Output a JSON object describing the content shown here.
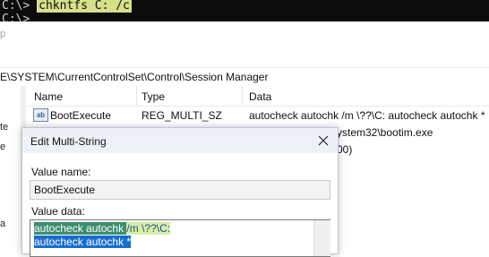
{
  "console": {
    "prompt1": "C:\\> ",
    "command": "chkntfs C: /c",
    "prompt2": "C:\\>"
  },
  "regedit": {
    "menu_fragment": "p",
    "address": "E\\SYSTEM\\CurrentControlSet\\Control\\Session Manager",
    "tree_fragments": [
      "te",
      "e",
      "a"
    ],
    "columns": {
      "name": "Name",
      "type": "Type",
      "data": "Data"
    },
    "rows": [
      {
        "icon": "ab",
        "name": "BootExecute",
        "type": "REG_MULTI_SZ",
        "data": "autocheck autochk /m \\??\\C: autocheck autochk *"
      },
      {
        "name": "",
        "type": "",
        "data": "ystem32\\bootim.exe"
      },
      {
        "name": "",
        "type": "",
        "data": "00)"
      }
    ]
  },
  "dialog": {
    "title": "Edit Multi-String",
    "value_name_label": "Value name:",
    "value_name": "BootExecute",
    "value_data_label": "Value data:",
    "value_data_lines": [
      "autocheck autochk /m \\??\\C:",
      "autocheck autochk *"
    ]
  }
}
